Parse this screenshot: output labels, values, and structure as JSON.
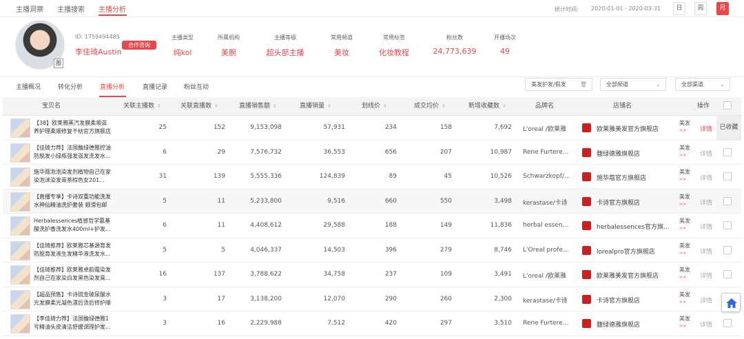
{
  "topnav": {
    "tabs": [
      "主播洞察",
      "主播搜索",
      "主播分析"
    ],
    "active_index": 2,
    "stats_label": "统计时间:",
    "date_range": "2020-01-01 - 2020-03-31",
    "period_buttons": [
      "日",
      "周",
      "月"
    ],
    "active_period": "月"
  },
  "profile": {
    "id": "ID: 1759494485",
    "name": "李佳琦Austin",
    "coop_button": "合作咨询",
    "avatar_badge": "图",
    "fields": [
      {
        "label": "主播类型",
        "value": "纯kol"
      },
      {
        "label": "所属机构",
        "value": "美腕"
      },
      {
        "label": "主播等级",
        "value": "超头部主播"
      },
      {
        "label": "常用频道",
        "value": "美妆"
      },
      {
        "label": "常用标签",
        "value": "化妆教程"
      },
      {
        "label": "粉丝数",
        "value": "24,773,639"
      },
      {
        "label": "开播场次",
        "value": "49"
      }
    ]
  },
  "subnav": {
    "tabs": [
      "主播概况",
      "转化分析",
      "直播分析",
      "直播记录",
      "粉丝互动"
    ],
    "active_index": 2,
    "category_filter": "美发护发/假发",
    "channel_filter": "全部频道",
    "channel_filter2": "全部渠道"
  },
  "table": {
    "headers": [
      "宝贝名",
      "关联主播数",
      "关联直播数",
      "直播销售额",
      "直播销量",
      "划线价",
      "成交均价",
      "新增收藏数",
      "品牌名",
      "店铺名",
      "",
      "操作"
    ],
    "rows": [
      {
        "product": "【38】欧莱雅蒸汽发膜柔顺滋养护理柔顺修复干枯官方旗舰店",
        "anchors": "25",
        "lives": "152",
        "sales": "9,153,098",
        "volume": "57,931",
        "list_price": "234",
        "avg_price": "158",
        "favorites": "7,692",
        "brand": "L'oreal /欧莱雅",
        "shop": "欧莱雅美发官方旗舰店",
        "extra": "美发",
        "action": "详情",
        "collected": "已收藏"
      },
      {
        "product": "【佳琦力荐】法国馥绿德雅控油防脱发小绿瓶强发滋发洗发水...",
        "anchors": "6",
        "lives": "29",
        "sales": "7,576,732",
        "volume": "36,553",
        "list_price": "656",
        "avg_price": "207",
        "favorites": "10,987",
        "brand": "Rene Furtere...",
        "shop": "馥绿德雅旗舰店",
        "extra": "美发",
        "action": "详情",
        "collected": ""
      },
      {
        "product": "施华蔻泡泡染发剂植物自己在家染泡沫染发膏茶棕色女201...",
        "anchors": "31",
        "lives": "139",
        "sales": "5,555,336",
        "volume": "124,839",
        "list_price": "89",
        "avg_price": "45",
        "favorites": "10,526",
        "brand": "Schwarzkopf/...",
        "shop": "施华蔻官方旗舰店",
        "extra": "美发",
        "action": "详情",
        "collected": ""
      },
      {
        "product": "【直播专享】卡诗双重功能洗发水神仙精油洗护套装 顺滑包邮",
        "anchors": "5",
        "lives": "11",
        "sales": "5,233,800",
        "volume": "9,516",
        "list_price": "660",
        "avg_price": "550",
        "favorites": "3,498",
        "brand": "kerastase/卡诗",
        "shop": "卡诗官方旗舰店",
        "extra": "美发",
        "action": "详情",
        "collected": ""
      },
      {
        "product": "Herbalessences植感哲学氨基酸洗护香洗发水400ml+护发...",
        "anchors": "6",
        "lives": "11",
        "sales": "4,408,612",
        "volume": "29,588",
        "list_price": "188",
        "avg_price": "149",
        "favorites": "11,836",
        "brand": "herbal essen...",
        "shop": "herbalessences官方旗...",
        "extra": "美发",
        "action": "详情",
        "collected": ""
      },
      {
        "product": "【佳琦推荐】欧莱雅芯基源育发防脱育发液生发精华液洗发水...",
        "anchors": "5",
        "lives": "5",
        "sales": "4,046,337",
        "volume": "14,503",
        "list_price": "396",
        "avg_price": "279",
        "favorites": "8,746",
        "brand": "L'Oreal profe...",
        "shop": "lorealpro官方旗舰店",
        "extra": "美发",
        "action": "详情",
        "collected": ""
      },
      {
        "product": "【佳琦推荐】欧莱雅卓韵霜染发剂自己在家染白发黑色染发膏...",
        "anchors": "16",
        "lives": "137",
        "sales": "3,788,622",
        "volume": "34,758",
        "list_price": "237",
        "avg_price": "109",
        "favorites": "3,491",
        "brand": "L'oreal /欧莱雅",
        "shop": "欧莱雅美发官方旗舰店",
        "extra": "美发",
        "action": "详情",
        "collected": ""
      },
      {
        "product": "【超品预售】卡诗琉金玻尿酸水光发膜柔光凝色漂后烫后修护顺丰...",
        "anchors": "3",
        "lives": "17",
        "sales": "3,138,200",
        "volume": "12,070",
        "list_price": "290",
        "avg_price": "260",
        "favorites": "2,300",
        "brand": "kerastase/卡诗",
        "shop": "卡诗官方旗舰店",
        "extra": "美发",
        "action": "详情",
        "collected": ""
      },
      {
        "product": "【李佳琦力荐】法国馥绿德雅1号精油头皮清洁舒缓调理护发...",
        "anchors": "3",
        "lives": "16",
        "sales": "2,229,988",
        "volume": "7,512",
        "list_price": "420",
        "avg_price": "297",
        "favorites": "3,510",
        "brand": "Rene Furtere...",
        "shop": "馥绿德雅旗舰店",
        "extra": "美发",
        "action": "详情",
        "collected": ""
      }
    ]
  },
  "colors": {
    "accent": "#e8474b"
  },
  "icons": {
    "home": "home-icon",
    "trash": "trash-icon",
    "shop": "shop-logo-icon"
  }
}
